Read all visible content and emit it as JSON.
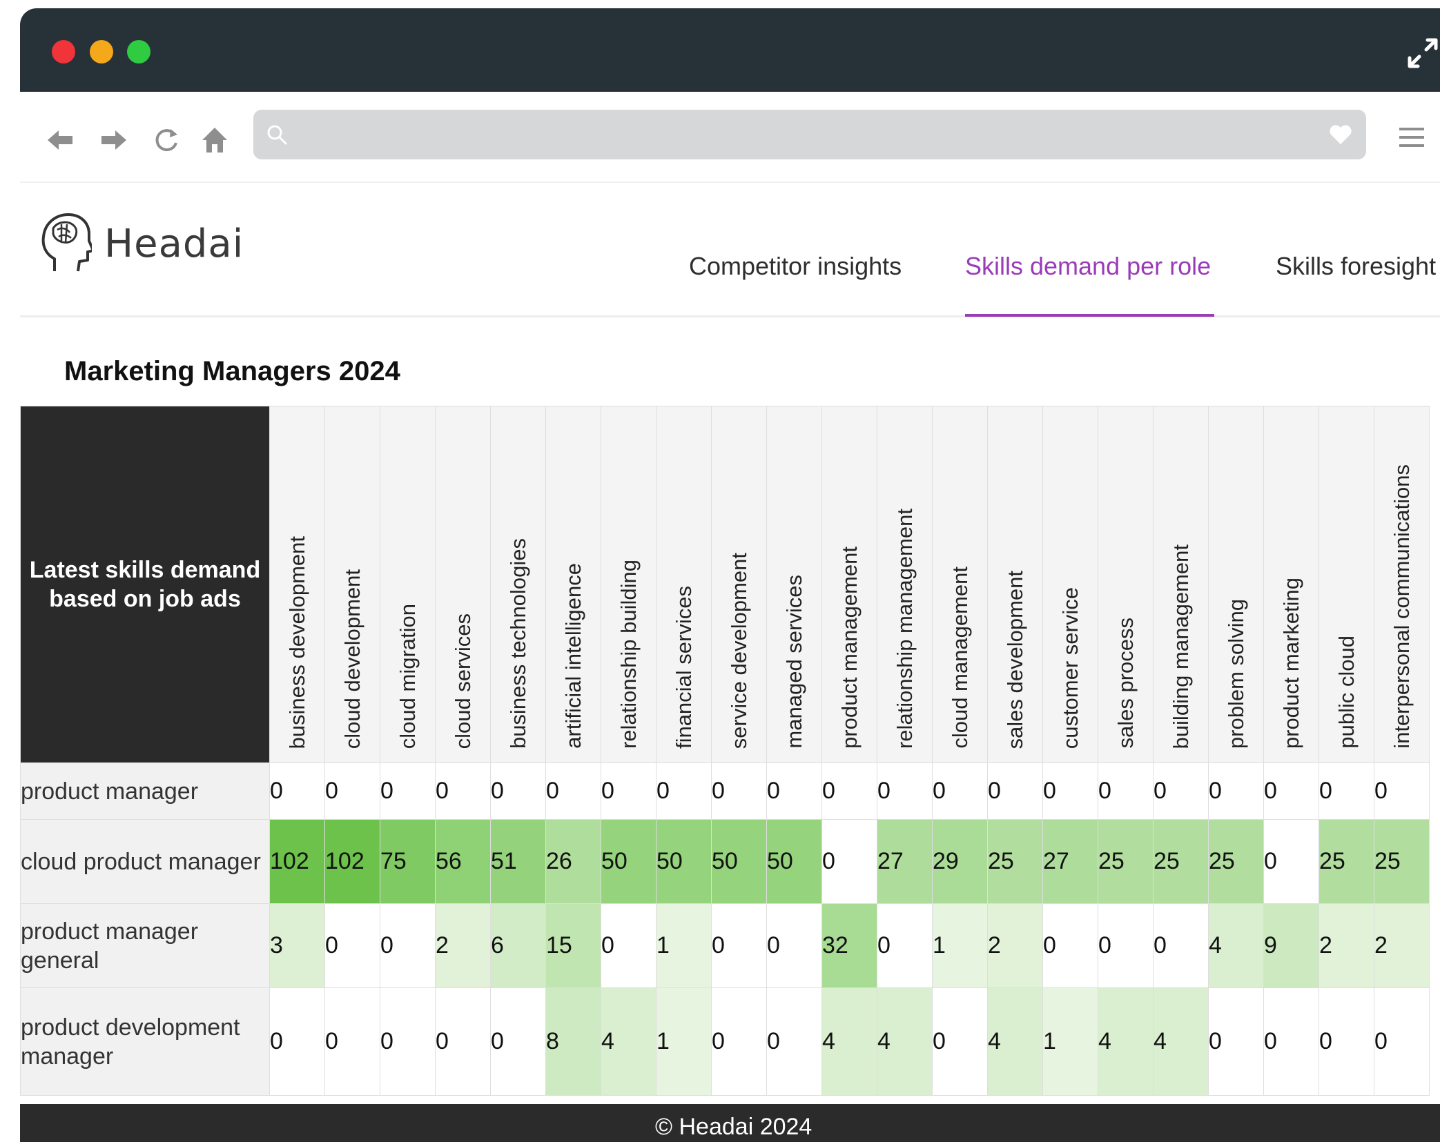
{
  "browser": {
    "url_value": "",
    "icons": {
      "back": "arrow-left-icon",
      "forward": "arrow-right-icon",
      "reload": "reload-icon",
      "home": "home-icon",
      "search": "search-icon",
      "favorite": "heart-icon",
      "menu": "hamburger-menu-icon",
      "expand": "expand-icon"
    },
    "colors": {
      "titlebar": "#263238",
      "close": "#f0343a",
      "minimize": "#f6a81b",
      "maximize": "#2fcb41"
    }
  },
  "app": {
    "brand": "Headai",
    "tabs": [
      {
        "label": "Competitor insights",
        "active": false
      },
      {
        "label": "Skills demand per role",
        "active": true
      },
      {
        "label": "Skills foresight",
        "active": false
      }
    ],
    "accent_color": "#9a3bb8"
  },
  "section": {
    "title": "Marketing Managers 2024"
  },
  "matrix": {
    "corner_label": "Latest skills demand based on job ads",
    "skills": [
      "business development",
      "cloud development",
      "cloud migration",
      "cloud services",
      "business technologies",
      "artificial intelligence",
      "relationship building",
      "financial services",
      "service development",
      "managed services",
      "product management",
      "relationship management",
      "cloud management",
      "sales development",
      "customer service",
      "sales process",
      "building management",
      "problem solving",
      "product marketing",
      "public cloud",
      "interpersonal communications"
    ],
    "rows": [
      {
        "role": "product manager",
        "values": [
          "0",
          "0",
          "0",
          "0",
          "0",
          "0",
          "0",
          "0",
          "0",
          "0",
          "0",
          "0",
          "0",
          "0",
          "0",
          "0",
          "0",
          "0",
          "0",
          "0",
          "0"
        ]
      },
      {
        "role": "cloud product manager",
        "values": [
          "102",
          "102",
          "75",
          "56",
          "51",
          "26",
          "50",
          "50",
          "50",
          "50",
          "0",
          "27",
          "29",
          "25",
          "27",
          "25",
          "25",
          "25",
          "0",
          "25",
          "25"
        ]
      },
      {
        "role": "product manager general",
        "values": [
          "3",
          "0",
          "0",
          "2",
          "6",
          "15",
          "0",
          "1",
          "0",
          "0",
          "32",
          "0",
          "1",
          "2",
          "0",
          "0",
          "0",
          "4",
          "9",
          "2",
          "2"
        ]
      },
      {
        "role": "product development manager",
        "values": [
          "0",
          "0",
          "0",
          "0",
          "0",
          "8",
          "4",
          "1",
          "0",
          "0",
          "4",
          "4",
          "0",
          "4",
          "1",
          "4",
          "4",
          "0",
          "0",
          "0",
          "0"
        ]
      }
    ],
    "heat_colors": {
      "max": "#6cc24a",
      "zero": "#ffffff"
    }
  },
  "footer": {
    "text": "© Headai 2024"
  }
}
